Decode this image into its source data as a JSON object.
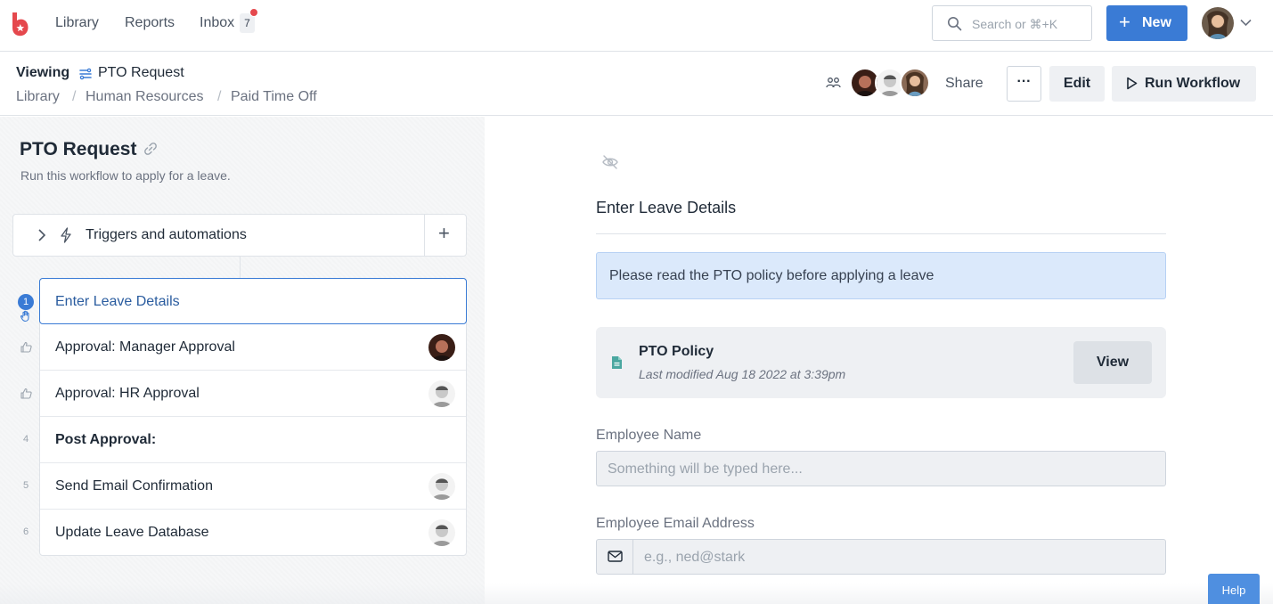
{
  "colors": {
    "accent": "#3a7bd5",
    "notice_bg": "#dbe9fb",
    "logo": "#e5484d",
    "badge_dot": "#e5484d"
  },
  "topnav": {
    "links": [
      "Library",
      "Reports",
      "Inbox"
    ],
    "inbox_count": "7",
    "search_placeholder": "Search or ⌘+K",
    "new_label": "New"
  },
  "subheader": {
    "viewing_label": "Viewing",
    "workflow_name": "PTO Request",
    "breadcrumb": [
      "Library",
      "Human Resources",
      "Paid Time Off"
    ],
    "share_label": "Share",
    "more_label": "···",
    "edit_label": "Edit",
    "run_label": "Run Workflow"
  },
  "left": {
    "title": "PTO Request",
    "description": "Run this workflow to apply for a leave.",
    "triggers_label": "Triggers and automations",
    "active_step_number": "1",
    "steps": [
      {
        "number": "1",
        "label": "Enter Leave Details",
        "icon": "hand-icon"
      },
      {
        "number": "",
        "label": "Approval: Manager Approval",
        "icon": "thumbs-up-icon"
      },
      {
        "number": "",
        "label": "Approval: HR Approval",
        "icon": "thumbs-up-icon"
      },
      {
        "number": "4",
        "label": "Post Approval:"
      },
      {
        "number": "5",
        "label": "Send Email Confirmation"
      },
      {
        "number": "6",
        "label": "Update Leave Database"
      }
    ]
  },
  "form": {
    "title": "Enter Leave Details",
    "notice": "Please read the PTO policy before applying a leave",
    "doc_name": "PTO Policy",
    "doc_meta": "Last modified Aug 18 2022 at 3:39pm",
    "doc_view_label": "View",
    "employee_name_label": "Employee Name",
    "employee_name_placeholder": "Something will be typed here...",
    "employee_email_label": "Employee Email Address",
    "employee_email_placeholder": "e.g., ned@stark"
  },
  "help_label": "Help"
}
